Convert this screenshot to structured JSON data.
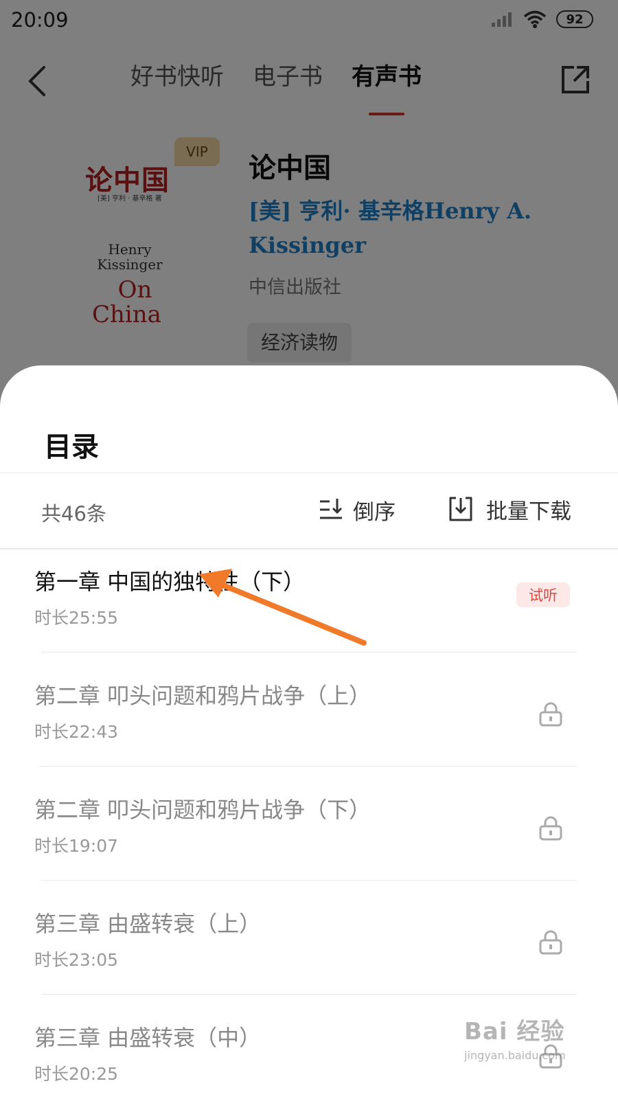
{
  "status_bar": {
    "time": "20:09",
    "battery": "92"
  },
  "nav": {
    "tabs": [
      {
        "label": "好书快听",
        "active": false
      },
      {
        "label": "电子书",
        "active": false
      },
      {
        "label": "有声书",
        "active": true
      }
    ]
  },
  "book": {
    "vip_label": "VIP",
    "cover": {
      "title_cn": "论中国",
      "subtitle": "[美] 亨利 · 基辛格 著",
      "author_en": "Henry Kissinger",
      "title_en_line1": "On",
      "title_en_line2": "China"
    },
    "title": "论中国",
    "author": "[美] 亨利· 基辛格Henry A. Kissinger",
    "publisher": "中信出版社",
    "tag": "经济读物"
  },
  "catalog": {
    "title": "目录",
    "count": "共46条",
    "sort_label": "倒序",
    "download_label": "批量下载",
    "trial_label": "试听",
    "chapters": [
      {
        "title": "第一章 中国的独特性（下）",
        "duration": "时长25:55",
        "trial": true
      },
      {
        "title": "第二章 叩头问题和鸦片战争（上）",
        "duration": "时长22:43",
        "trial": false
      },
      {
        "title": "第二章 叩头问题和鸦片战争（下）",
        "duration": "时长19:07",
        "trial": false
      },
      {
        "title": "第三章 由盛转衰（上）",
        "duration": "时长23:05",
        "trial": false
      },
      {
        "title": "第三章 由盛转衰（中）",
        "duration": "时长20:25",
        "trial": false
      }
    ]
  },
  "watermark": {
    "logo": "Bai 经验",
    "url": "jingyan.baidu.com"
  },
  "colors": {
    "accent": "#d4312d",
    "author_link": "#1e80c8",
    "trial_bg": "#fde8e8",
    "trial_text": "#e0463e",
    "arrow": "#f07a2a"
  },
  "icons": [
    "back-icon",
    "share-icon",
    "signal-icon",
    "wifi-icon",
    "battery-icon",
    "sort-icon",
    "download-icon",
    "lock-icon",
    "arrow-annotation"
  ]
}
